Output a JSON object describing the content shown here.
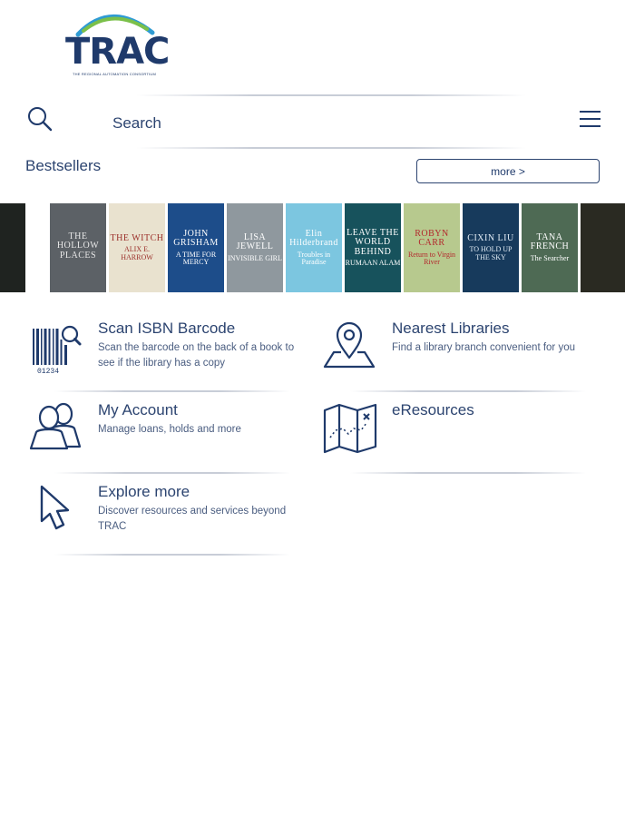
{
  "logo": {
    "text": "TRAC",
    "tagline": "THE REGIONAL AUTOMATION CONSORTIUM"
  },
  "search": {
    "placeholder": "Search"
  },
  "bestsellers": {
    "title": "Bestsellers",
    "more_label": "more >",
    "books": [
      {
        "line1": "",
        "line2": "",
        "bg": "#1f2320",
        "fg": "#c9a24a"
      },
      {
        "line1": "THE HOLLOW PLACES",
        "line2": "",
        "bg": "#5c6166",
        "fg": "#e8e8e8"
      },
      {
        "line1": "THE WITCH",
        "line2": "ALIX E. HARROW",
        "bg": "#e9e2cf",
        "fg": "#9b2f2a"
      },
      {
        "line1": "JOHN GRISHAM",
        "line2": "A TIME FOR MERCY",
        "bg": "#1d4d8a",
        "fg": "#ffffff"
      },
      {
        "line1": "LISA JEWELL",
        "line2": "INVISIBLE GIRL",
        "bg": "#8f989e",
        "fg": "#ffffff"
      },
      {
        "line1": "Elin Hilderbrand",
        "line2": "Troubles in Paradise",
        "bg": "#7cc6e0",
        "fg": "#ffffff"
      },
      {
        "line1": "LEAVE THE WORLD BEHIND",
        "line2": "RUMAAN ALAM",
        "bg": "#17525c",
        "fg": "#ffffff"
      },
      {
        "line1": "ROBYN CARR",
        "line2": "Return to Virgin River",
        "bg": "#b7c98e",
        "fg": "#b3282d"
      },
      {
        "line1": "CIXIN LIU",
        "line2": "TO HOLD UP THE SKY",
        "bg": "#173a5c",
        "fg": "#e2ecf5"
      },
      {
        "line1": "TANA FRENCH",
        "line2": "The Searcher",
        "bg": "#4e6a54",
        "fg": "#ffffff"
      },
      {
        "line1": "",
        "line2": "",
        "bg": "#2a2a22",
        "fg": "#c9a24a"
      }
    ]
  },
  "tiles": {
    "scan": {
      "title": "Scan ISBN Barcode",
      "desc": "Scan the barcode on the back of a book to see if the library has a copy",
      "barcode_digits": "01234"
    },
    "nearest": {
      "title": "Nearest Libraries",
      "desc": "Find a library branch convenient for you"
    },
    "account": {
      "title": "My Account",
      "desc": "Manage loans, holds and more"
    },
    "eresources": {
      "title": "eResources",
      "desc": ""
    },
    "explore": {
      "title": "Explore more",
      "desc": "Discover resources and services beyond TRAC"
    }
  },
  "colors": {
    "brand_navy": "#1f3a6b",
    "arc_green": "#7bc04a",
    "arc_blue": "#2f9bd3"
  },
  "icons": [
    "search-icon",
    "menu-icon",
    "barcode-icon",
    "map-pin-icon",
    "users-icon",
    "map-icon",
    "pointer-cursor-icon"
  ]
}
